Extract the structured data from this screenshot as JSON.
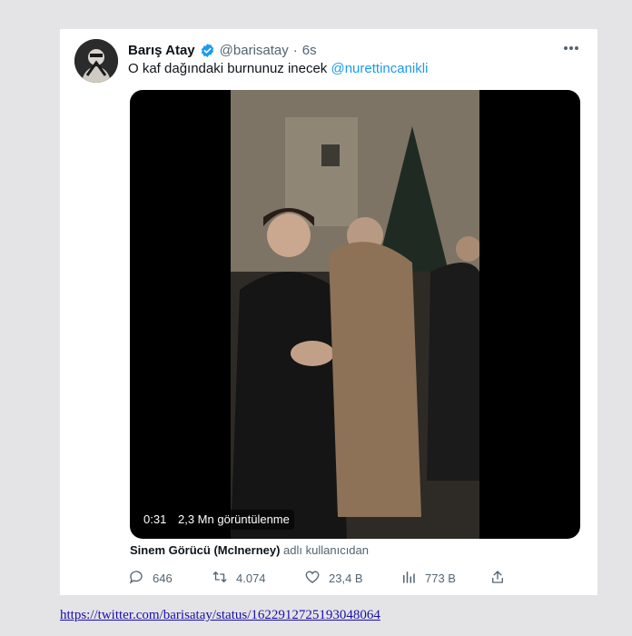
{
  "tweet": {
    "display_name": "Barış Atay",
    "handle": "@barisatay",
    "separator": "·",
    "time": "6s",
    "text": "O kaf dağındaki burnunuz inecek",
    "mention": "@nurettincanikli",
    "more_icon": "more-horizontal-icon",
    "verified_icon": "verified-badge-icon"
  },
  "media": {
    "duration": "0:31",
    "views": "2,3 Mn görüntülenme"
  },
  "attribution": {
    "user": "Sinem Görücü (McInerney)",
    "suffix": "adlı kullanıcıdan"
  },
  "actions": {
    "replies": "646",
    "retweets": "4.074",
    "likes": "23,4 B",
    "views": "773 B"
  },
  "link": {
    "url": "https://twitter.com/barisatay/status/1622912725193048064"
  },
  "colors": {
    "accent": "#1d9bf0",
    "text": "#0f1419",
    "muted": "#536471",
    "link": "#1a0dab"
  }
}
